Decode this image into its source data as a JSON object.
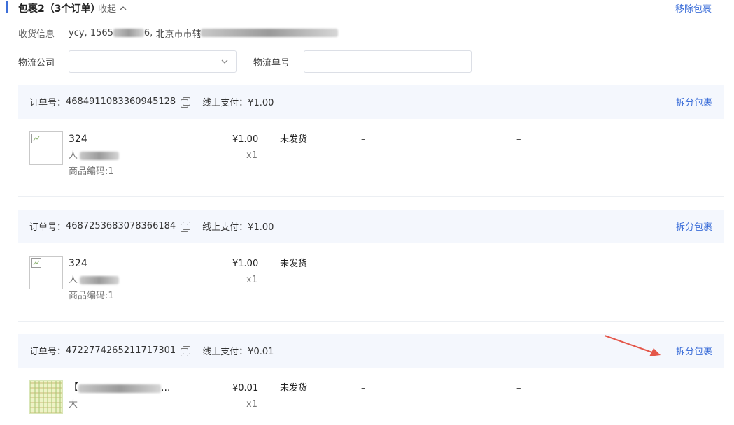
{
  "package": {
    "title": "包裹2（3个订单）",
    "collapse_label": "收起",
    "remove_label": "移除包裹"
  },
  "shipping": {
    "label": "收货信息",
    "name": "ycy,",
    "phone_start": "1565",
    "phone_end": "6,",
    "address_start": "北京市市辖"
  },
  "logistics": {
    "company_label": "物流公司",
    "company_value": "",
    "tracking_label": "物流单号",
    "tracking_value": ""
  },
  "orders": [
    {
      "order_id_label": "订单号：",
      "order_id": "4684911083360945128",
      "payment": "线上支付：¥1.00",
      "split_label": "拆分包裹",
      "item": {
        "name": "324",
        "sub_prefix": "人",
        "code": "商品编码:1",
        "price": "¥1.00",
        "qty": "x1",
        "status": "未发货",
        "col4": "–",
        "col5": "–"
      }
    },
    {
      "order_id_label": "订单号：",
      "order_id": "4687253683078366184",
      "payment": "线上支付：¥1.00",
      "split_label": "拆分包裹",
      "item": {
        "name": "324",
        "sub_prefix": "人",
        "code": "商品编码:1",
        "price": "¥1.00",
        "qty": "x1",
        "status": "未发货",
        "col4": "–",
        "col5": "–"
      }
    },
    {
      "order_id_label": "订单号：",
      "order_id": "4722774265211717301",
      "payment": "线上支付：¥0.01",
      "split_label": "拆分包裹",
      "item": {
        "name_prefix": "【",
        "name_suffix": "...",
        "sub": "大",
        "price": "¥0.01",
        "qty": "x1",
        "status": "未发货",
        "col4": "–",
        "col5": "–"
      }
    }
  ],
  "colors": {
    "accent": "#3d6fd9",
    "order_header_bg": "#f4f7fd",
    "annotation_arrow": "#e4574a"
  },
  "icons": [
    "chevron-up-icon",
    "chevron-down-icon",
    "copy-icon",
    "broken-image-icon",
    "annotation-arrow"
  ]
}
